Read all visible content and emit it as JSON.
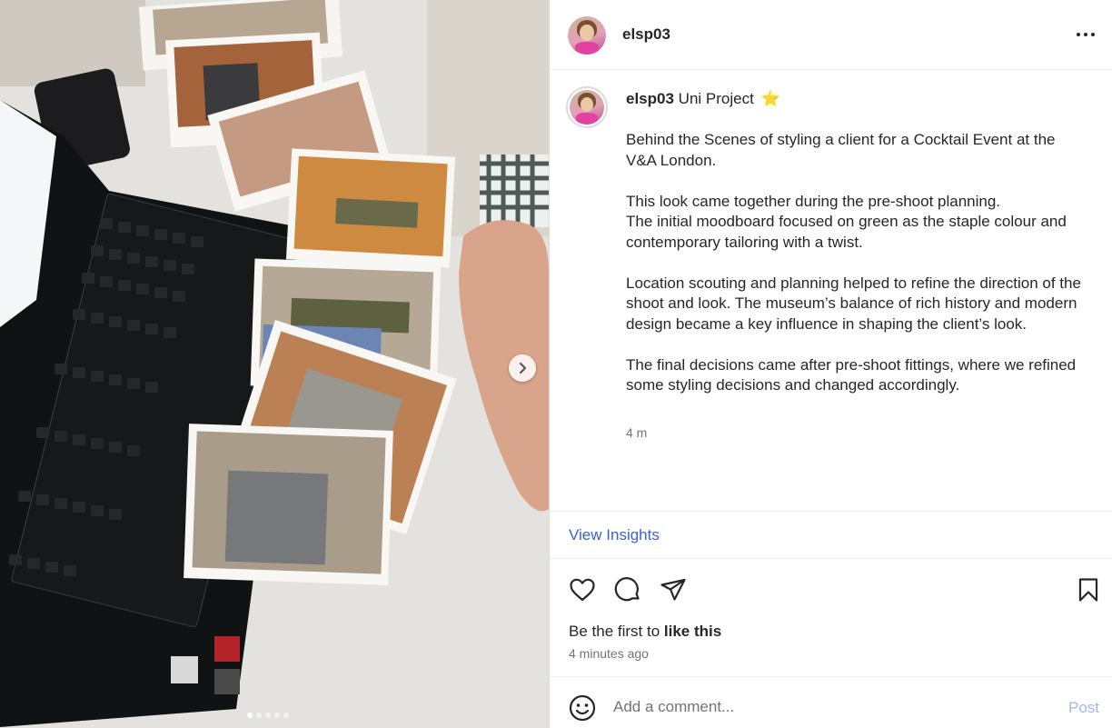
{
  "post": {
    "username": "elsp03",
    "caption_title": "Uni Project",
    "caption_emoji": "⭐",
    "caption_paragraphs": [
      "Behind the Scenes of styling a client for a Cocktail Event at the V&A London.",
      "This look came together during the pre-shoot planning.\nThe initial moodboard focused on green as the staple colour and contemporary tailoring with a twist.",
      "Location scouting and planning helped to refine the direction of the shoot and look. The museum’s balance of rich history and modern design became a key influence in shaping the client’s look.",
      "The final decisions came after pre-shoot fittings, where we refined some styling decisions and changed accordingly."
    ],
    "caption_time": "4 m",
    "insights_label": "View Insights",
    "likes_prefix": "Be the first to ",
    "likes_action": "like this",
    "posted_ago": "4 minutes ago",
    "comment_placeholder": "Add a comment...",
    "post_label": "Post"
  },
  "carousel": {
    "slide_count": 5,
    "active_index": 0
  },
  "icons": {
    "more": "more-options-icon",
    "like": "heart-icon",
    "comment": "comment-bubble-icon",
    "share": "paper-plane-icon",
    "save": "bookmark-icon",
    "emoji": "emoji-smile-icon",
    "next": "chevron-right-icon"
  },
  "colors": {
    "link": "#3a5fd1",
    "post_disabled": "#9fb8e8",
    "muted_text": "#737373",
    "divider": "#efefef"
  }
}
